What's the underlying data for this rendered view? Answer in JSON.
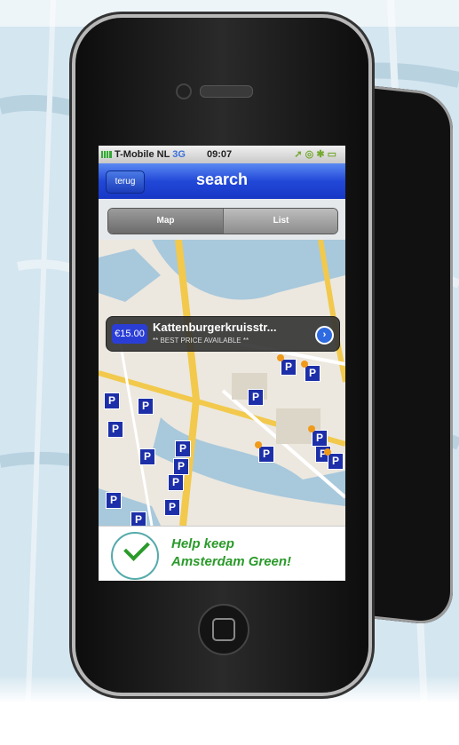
{
  "status_bar": {
    "carrier": "T-Mobile NL",
    "network": "3G",
    "time": "09:07"
  },
  "nav": {
    "back_label": "terug",
    "title": "search"
  },
  "segments": {
    "map_label": "Map",
    "list_label": "List"
  },
  "callout": {
    "price": "€15.00",
    "title": "Kattenburgerkruisstr...",
    "subtitle": "** BEST PRICE AVAILABLE **"
  },
  "map_pin_label": "P",
  "banner": {
    "line1": "Help keep",
    "line2": "Amsterdam Green!"
  },
  "colors": {
    "nav_blue": "#2248d8",
    "pin_blue": "#1d2fa8",
    "banner_green": "#2a9a2a"
  }
}
